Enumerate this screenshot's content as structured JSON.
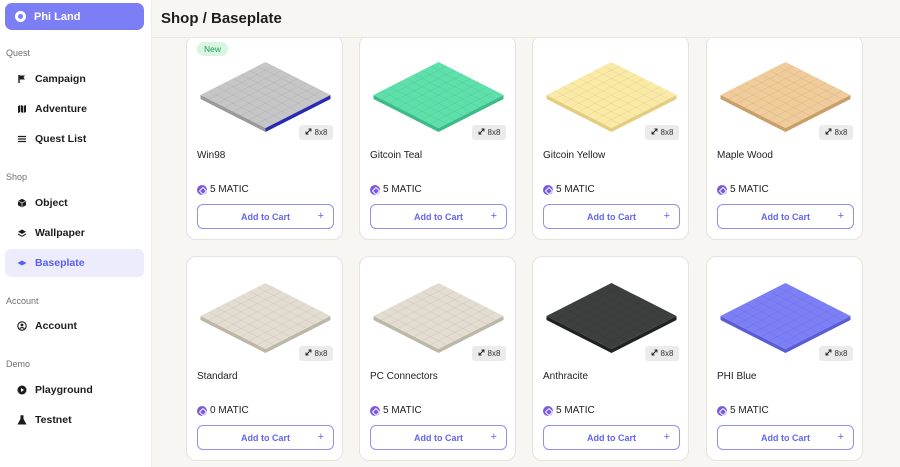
{
  "sidebar": {
    "brand_label": "Phi Land",
    "sections": {
      "quest": "Quest",
      "shop": "Shop",
      "account": "Account",
      "demo": "Demo"
    },
    "items": {
      "campaign": "Campaign",
      "adventure": "Adventure",
      "quest_list": "Quest List",
      "object": "Object",
      "wallpaper": "Wallpaper",
      "baseplate": "Baseplate",
      "account": "Account",
      "playground": "Playground",
      "testnet": "Testnet"
    },
    "active_item": "baseplate"
  },
  "header": {
    "title": "Shop / Baseplate"
  },
  "cards": [
    {
      "name": "Win98",
      "price": "5 MATIC",
      "size": "8x8",
      "badge": "New",
      "colors": {
        "top": "#c6c6c6",
        "side": "#9a9a9a",
        "edge": "#2a2ab0"
      },
      "add_label": "Add to Cart"
    },
    {
      "name": "Gitcoin Teal",
      "price": "5 MATIC",
      "size": "8x8",
      "badge": "",
      "colors": {
        "top": "#5ee0ab",
        "side": "#3dbb8a"
      },
      "add_label": "Add to Cart"
    },
    {
      "name": "Gitcoin Yellow",
      "price": "5 MATIC",
      "size": "8x8",
      "badge": "",
      "colors": {
        "top": "#fbeaa6",
        "side": "#e3cd7e"
      },
      "add_label": "Add to Cart"
    },
    {
      "name": "Maple Wood",
      "price": "5 MATIC",
      "size": "8x8",
      "badge": "",
      "colors": {
        "top": "#efcc9a",
        "side": "#c9a06a"
      },
      "add_label": "Add to Cart"
    },
    {
      "name": "Standard",
      "price": "0 MATIC",
      "size": "8x8",
      "badge": "",
      "colors": {
        "top": "#e2ddd0",
        "side": "#bdb7a8"
      },
      "add_label": "Add to Cart"
    },
    {
      "name": "PC Connectors",
      "price": "5 MATIC",
      "size": "8x8",
      "badge": "",
      "colors": {
        "top": "#e2ddd0",
        "side": "#bdb7a8"
      },
      "add_label": "Add to Cart"
    },
    {
      "name": "Anthracite",
      "price": "5 MATIC",
      "size": "8x8",
      "badge": "",
      "colors": {
        "top": "#3c3f3d",
        "side": "#202221"
      },
      "add_label": "Add to Cart"
    },
    {
      "name": "PHI Blue",
      "price": "5 MATIC",
      "size": "8x8",
      "badge": "",
      "colors": {
        "top": "#7d7ff6",
        "side": "#5b5dd4"
      },
      "add_label": "Add to Cart"
    }
  ]
}
